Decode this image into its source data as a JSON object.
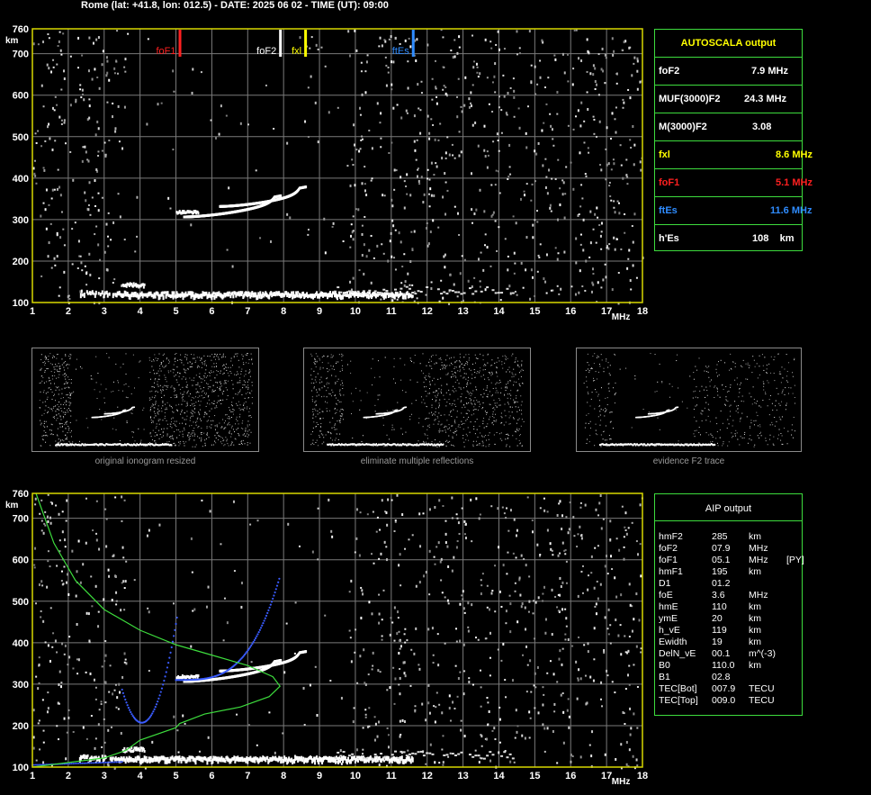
{
  "header": {
    "title": "Rome (lat: +41.8, lon: 012.5) - DATE: 2025 06 02 - TIME (UT): 09:00"
  },
  "ionogram": {
    "x_unit": "MHz",
    "y_unit": "km",
    "x_ticks": [
      "1",
      "2",
      "3",
      "4",
      "5",
      "6",
      "7",
      "8",
      "9",
      "10",
      "11",
      "12",
      "13",
      "14",
      "15",
      "16",
      "17",
      "18"
    ],
    "y_ticks_top": [
      "100",
      "200",
      "300",
      "400",
      "500",
      "600",
      "700",
      "760"
    ],
    "markers": [
      {
        "label": "foF1",
        "freq": 5.1,
        "color": "#ff2020"
      },
      {
        "label": "foF2",
        "freq": 7.9,
        "color": "#ffffff"
      },
      {
        "label": "fxl",
        "freq": 8.6,
        "color": "#ffff00"
      },
      {
        "label": "ftEs",
        "freq": 11.6,
        "color": "#2f8cff"
      }
    ],
    "axis_color": "#d8d800",
    "grid_color": "#7a7a7a"
  },
  "autoscala": {
    "title": "AUTOSCALA output",
    "rows": [
      {
        "label": "foF2",
        "value": "7.9 MHz",
        "color": "#ffffff"
      },
      {
        "label": "MUF(3000)F2",
        "value": "24.3 MHz",
        "color": "#ffffff"
      },
      {
        "label": "M(3000)F2",
        "value": "3.08",
        "color": "#ffffff"
      },
      {
        "label": "fxl",
        "value": "8.6 MHz",
        "color": "#ffff00"
      },
      {
        "label": "foF1",
        "value": "5.1 MHz",
        "color": "#ff2020"
      },
      {
        "label": "ftEs",
        "value": "11.6 MHz",
        "color": "#2f8cff"
      },
      {
        "label": "h'Es",
        "value": "108    km",
        "color": "#ffffff"
      }
    ]
  },
  "thumbnails": {
    "captions": [
      "original ionogram resized",
      "eliminate multiple reflections",
      "evidence F2 trace"
    ]
  },
  "aip": {
    "title": "AIP output",
    "rows": [
      {
        "name": "hmF2",
        "value": "285",
        "unit": "km",
        "flag": ""
      },
      {
        "name": "foF2",
        "value": "07.9",
        "unit": "MHz",
        "flag": ""
      },
      {
        "name": "foF1",
        "value": "05.1",
        "unit": "MHz",
        "flag": "[PY]"
      },
      {
        "name": "hmF1",
        "value": "195",
        "unit": "km",
        "flag": ""
      },
      {
        "name": "D1",
        "value": "01.2",
        "unit": "",
        "flag": ""
      },
      {
        "name": "foE",
        "value": "3.6",
        "unit": "MHz",
        "flag": ""
      },
      {
        "name": "hmE",
        "value": "110",
        "unit": "km",
        "flag": ""
      },
      {
        "name": "ymE",
        "value": "20",
        "unit": "km",
        "flag": ""
      },
      {
        "name": "h_vE",
        "value": "119",
        "unit": "km",
        "flag": ""
      },
      {
        "name": "Ewidth",
        "value": "19",
        "unit": "km",
        "flag": ""
      },
      {
        "name": "DelN_vE",
        "value": "00.1",
        "unit": "m^(-3)",
        "flag": ""
      },
      {
        "name": "B0",
        "value": "110.0",
        "unit": "km",
        "flag": ""
      },
      {
        "name": "B1",
        "value": "02.8",
        "unit": "",
        "flag": ""
      },
      {
        "name": "TEC[Bot]",
        "value": "007.9",
        "unit": "TECU",
        "flag": ""
      },
      {
        "name": "TEC[Top]",
        "value": "009.0",
        "unit": "TECU",
        "flag": ""
      }
    ]
  }
}
